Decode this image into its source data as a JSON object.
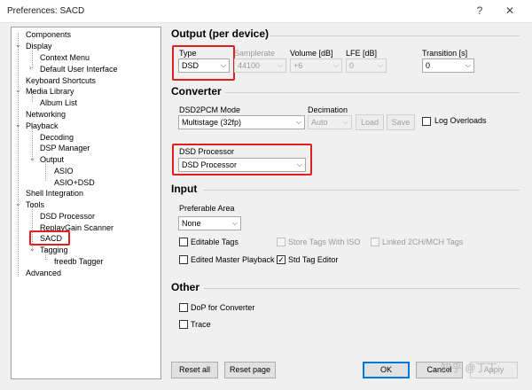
{
  "window": {
    "title": "Preferences: SACD",
    "help_glyph": "?",
    "close_glyph": "✕"
  },
  "tree": {
    "items": [
      "Components",
      "Display",
      "Context Menu",
      "Default User Interface",
      "Keyboard Shortcuts",
      "Media Library",
      "Album List",
      "Networking",
      "Playback",
      "Decoding",
      "DSP Manager",
      "Output",
      "ASIO",
      "ASIO+DSD",
      "Shell Integration",
      "Tools",
      "DSD Processor",
      "ReplayGain Scanner",
      "SACD",
      "Tagging",
      "freedb Tagger",
      "Advanced"
    ],
    "selected": "SACD"
  },
  "output": {
    "heading": "Output (per device)",
    "type_label": "Type",
    "type_value": "DSD",
    "samplerate_label": "Samplerate",
    "samplerate_value": "44100",
    "volume_label": "Volume [dB]",
    "volume_value": "+6",
    "lfe_label": "LFE [dB]",
    "lfe_value": "0",
    "transition_label": "Transition [s]",
    "transition_value": "0"
  },
  "converter": {
    "heading": "Converter",
    "mode_label": "DSD2PCM Mode",
    "mode_value": "Multistage (32fp)",
    "decimation_label": "Decimation",
    "decimation_value": "Auto",
    "load_label": "Load",
    "save_label": "Save",
    "log_overloads_label": "Log Overloads",
    "dsd_processor_label": "DSD Processor",
    "dsd_processor_value": "DSD Processor"
  },
  "input": {
    "heading": "Input",
    "preferable_area_label": "Preferable Area",
    "preferable_area_value": "None",
    "editable_tags": "Editable Tags",
    "store_tags": "Store Tags With ISO",
    "linked_tags": "Linked 2CH/MCH Tags",
    "edited_master": "Edited Master Playback",
    "std_tag_editor": "Std Tag Editor",
    "std_tag_editor_checked": "✓"
  },
  "other": {
    "heading": "Other",
    "dop": "DoP for Converter",
    "trace": "Trace"
  },
  "footer": {
    "reset_all": "Reset all",
    "reset_page": "Reset page",
    "ok": "OK",
    "cancel": "Cancel",
    "apply": "Apply"
  },
  "watermark": "知乎 @丁丁",
  "colors": {
    "highlight": "#e02020",
    "focus": "#0078d7"
  }
}
